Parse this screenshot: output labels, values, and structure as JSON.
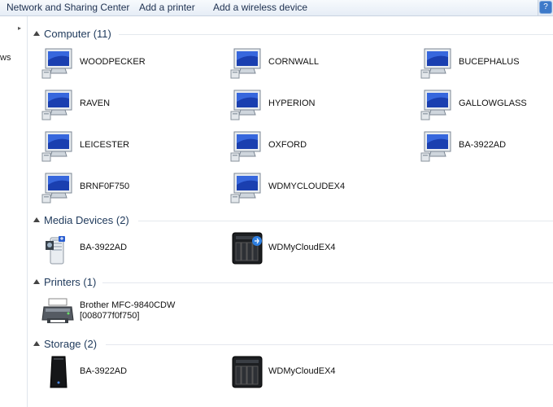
{
  "toolbar": {
    "items": [
      "Network and Sharing Center",
      "Add a printer",
      "Add a wireless device"
    ],
    "help": "?"
  },
  "nav": {
    "partial_text": "ws"
  },
  "groups": {
    "computer": {
      "title": "Computer (11)",
      "items": [
        "WOODPECKER",
        "CORNWALL",
        "BUCEPHALUS",
        "RAVEN",
        "HYPERION",
        "GALLOWGLASS",
        "LEICESTER",
        "OXFORD",
        "BA-3922AD",
        "BRNF0F750",
        "WDMYCLOUDEX4"
      ]
    },
    "media": {
      "title": "Media Devices (2)",
      "items": [
        "BA-3922AD",
        "WDMyCloudEX4"
      ]
    },
    "printers": {
      "title": "Printers (1)",
      "items": [
        {
          "line1": "Brother MFC-9840CDW",
          "line2": "[008077f0f750]"
        }
      ]
    },
    "storage": {
      "title": "Storage (2)",
      "items": [
        "BA-3922AD",
        "WDMyCloudEX4"
      ]
    }
  },
  "icons": {
    "computer": "computer-monitor-icon",
    "media_server": "media-server-icon",
    "nas": "nas-drive-icon",
    "printer": "printer-icon",
    "storage_tower": "storage-tower-icon"
  },
  "colors": {
    "toolbar_text": "#1e3150",
    "group_title": "#1e395b",
    "screen_blue": "#1a3fb0"
  }
}
